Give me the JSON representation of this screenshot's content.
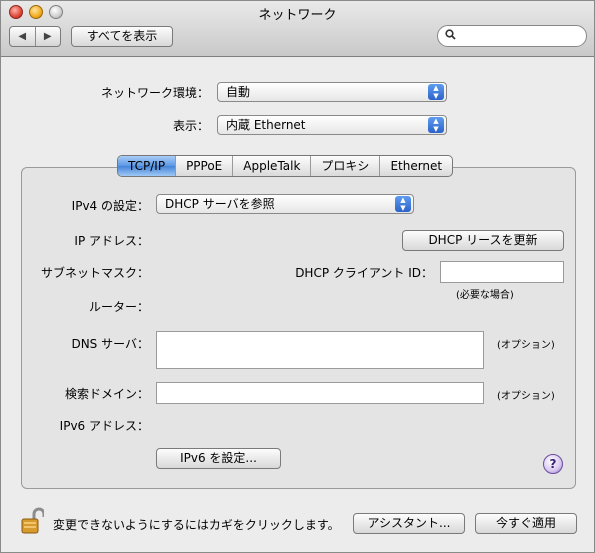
{
  "window": {
    "title": "ネットワーク"
  },
  "toolbar": {
    "back_glyph": "◀",
    "forward_glyph": "▶",
    "show_all_label": "すべてを表示",
    "search_placeholder": ""
  },
  "location": {
    "label": "ネットワーク環境：",
    "value": "自動"
  },
  "show": {
    "label": "表示：",
    "value": "内蔵 Ethernet"
  },
  "tabs": [
    {
      "label": "TCP/IP",
      "active": true
    },
    {
      "label": "PPPoE"
    },
    {
      "label": "AppleTalk"
    },
    {
      "label": "プロキシ"
    },
    {
      "label": "Ethernet"
    }
  ],
  "tcpip": {
    "ipv4_label": "IPv4 の設定：",
    "ipv4_value": "DHCP サーバを参照",
    "ip_address_label": "IP アドレス：",
    "renew_button": "DHCP リースを更新",
    "subnet_label": "サブネットマスク：",
    "dhcp_client_id_label": "DHCP クライアント ID：",
    "dhcp_client_id_value": "",
    "if_required": "(必要な場合)",
    "router_label": "ルーター：",
    "dns_label": "DNS サーバ：",
    "dns_value": "",
    "dns_optional": "(オプション)",
    "search_domain_label": "検索ドメイン：",
    "search_domain_value": "",
    "search_optional": "(オプション)",
    "ipv6_label": "IPv6 アドレス：",
    "ipv6_button": "IPv6 を設定..."
  },
  "help": {
    "glyph": "?"
  },
  "footer": {
    "lock_text": "変更できないようにするにはカギをクリックします。",
    "assistant_button": "アシスタント...",
    "apply_button": "今すぐ適用"
  }
}
